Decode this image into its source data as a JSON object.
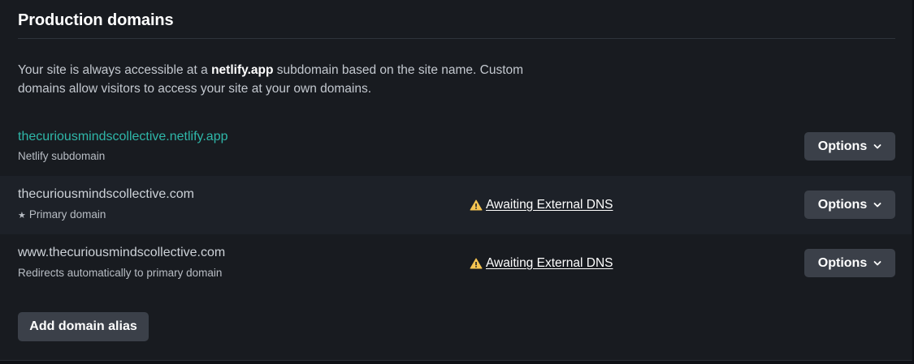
{
  "section": {
    "title": "Production domains",
    "description_prefix": "Your site is always accessible at a ",
    "description_strong": "netlify.app",
    "description_suffix": " subdomain based on the site name. Custom domains allow visitors to access your site at your own domains."
  },
  "domains": [
    {
      "name": "thecuriousmindscollective.netlify.app",
      "subtitle": "Netlify subdomain",
      "status": "",
      "options_label": "Options"
    },
    {
      "name": "thecuriousmindscollective.com",
      "subtitle": "Primary domain",
      "status": "Awaiting External DNS",
      "options_label": "Options"
    },
    {
      "name": "www.thecuriousmindscollective.com",
      "subtitle": "Redirects automatically to primary domain",
      "status": "Awaiting External DNS",
      "options_label": "Options"
    }
  ],
  "actions": {
    "add_alias_label": "Add domain alias"
  },
  "icons": {
    "star": "star-icon",
    "warning": "warning-triangle-icon",
    "chevron": "chevron-down-icon"
  },
  "colors": {
    "link": "#2fb7a9",
    "warning": "#f5c451",
    "button_bg": "#3b4049",
    "card_bg": "#181b20"
  }
}
